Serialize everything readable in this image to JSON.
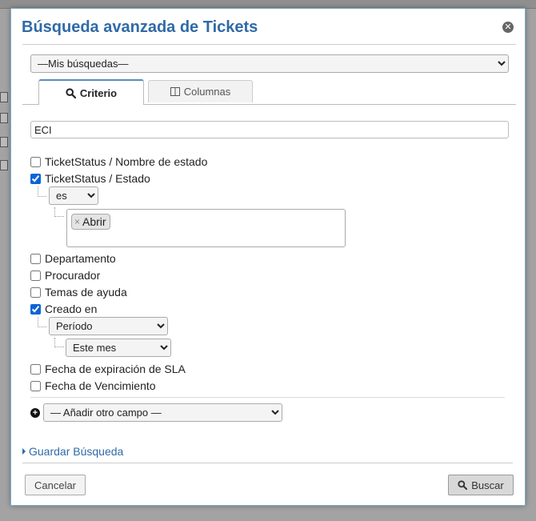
{
  "dialog": {
    "title": "Búsqueda avanzada de Tickets"
  },
  "my_searches": {
    "selected": "—Mis búsquedas—"
  },
  "tabs": [
    {
      "label": "Criterio",
      "active": true,
      "icon": "search-icon"
    },
    {
      "label": "Columnas",
      "active": false,
      "icon": "columns-icon"
    }
  ],
  "keywords": {
    "value": "ECI"
  },
  "criteria": {
    "ticket_status_name": {
      "label": "TicketStatus / Nombre de estado",
      "checked": false
    },
    "ticket_status_state": {
      "label": "TicketStatus / Estado",
      "checked": true,
      "operator": "es",
      "tags": [
        "Abrir"
      ],
      "tag_remove": "×"
    },
    "department": {
      "label": "Departamento",
      "checked": false
    },
    "assignee": {
      "label": "Procurador",
      "checked": false
    },
    "help_topics": {
      "label": "Temas de ayuda",
      "checked": false
    },
    "created": {
      "label": "Creado en",
      "checked": true,
      "operator": "Período",
      "period": "Este mes"
    },
    "sla_due": {
      "label": "Fecha de expiración de SLA",
      "checked": false
    },
    "due_date": {
      "label": "Fecha de Vencimiento",
      "checked": false
    }
  },
  "add_field": {
    "selected": "— Añadir otro campo —"
  },
  "save_search": {
    "label": "Guardar Búsqueda"
  },
  "buttons": {
    "cancel": "Cancelar",
    "search": "Buscar"
  },
  "colors": {
    "title": "#2f6aa7",
    "link": "#2f6aa7",
    "tab_accent": "#5b8bc0"
  }
}
